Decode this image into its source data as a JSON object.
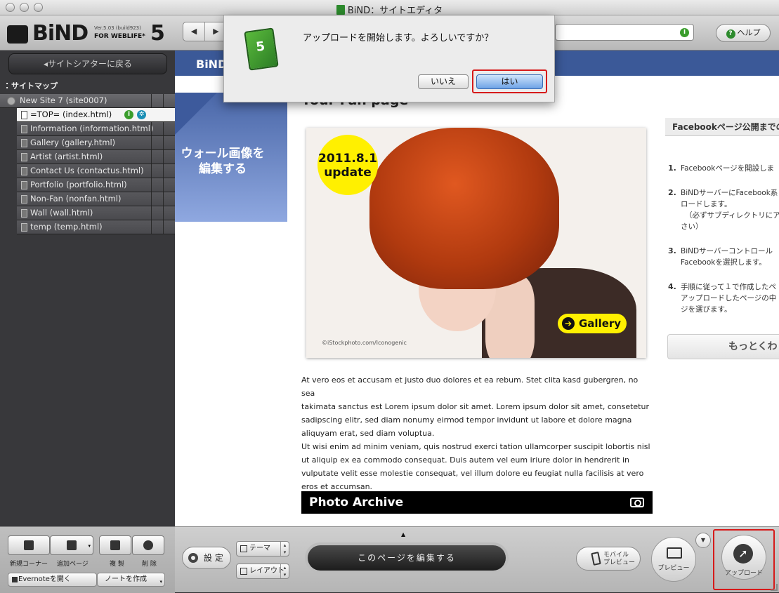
{
  "window": {
    "title": "BiND：サイトエディタ"
  },
  "logo": {
    "name": "BiND",
    "version": "Ver.5.03 (build923)",
    "subtitle": "FOR WEBLIFE*",
    "number": "5"
  },
  "nav": {
    "back": "◀",
    "forward": "▶"
  },
  "help_label": "ヘルプ",
  "sidebar": {
    "back_label": "◂サイトシアターに戻る",
    "sitemap_title": "サイトマップ",
    "root": "New Site 7 (site0007)",
    "pages": [
      {
        "label": "=TOP= (index.html)",
        "selected": true
      },
      {
        "label": "Information (information.html)"
      },
      {
        "label": "Gallery (gallery.html)"
      },
      {
        "label": "Artist (artist.html)"
      },
      {
        "label": "Contact Us (contactus.html)"
      },
      {
        "label": "Portfolio (portfolio.html)"
      },
      {
        "label": "Non-Fan (nonfan.html)"
      },
      {
        "label": "Wall (wall.html)"
      },
      {
        "label": "temp (temp.html)"
      }
    ]
  },
  "page": {
    "header_logo": "BiND",
    "wall_text_line1": "ウォール画像を",
    "wall_text_line2": "編集する",
    "fan_heading": "Your Fan page",
    "date_line1": "2011.8.1",
    "date_line2": "update",
    "gallery_label": "Gallery",
    "credit": "©iStockphoto.com/Iconogenic",
    "body_lines": [
      "At vero eos et accusam et justo duo dolores et ea rebum. Stet clita kasd gubergren, no sea",
      "takimata sanctus est Lorem ipsum dolor sit amet. Lorem ipsum dolor sit amet, consetetur",
      "sadipscing elitr, sed diam nonumy eirmod tempor invidunt ut labore et dolore magna",
      "aliquyam erat, sed diam voluptua.",
      "Ut wisi enim ad minim veniam, quis nostrud exerci tation ullamcorper suscipit lobortis nisl",
      "ut aliquip ex ea commodo consequat. Duis autem vel eum iriure dolor in hendrerit in",
      "vulputate velit esse molestie consequat, vel illum dolore eu feugiat nulla facilisis at vero",
      "eros et accumsan."
    ],
    "archive_title": "Photo Archive",
    "right_box_title": "Facebookページ公開までの",
    "steps": [
      {
        "num": "1.",
        "lines": [
          "Facebookページを開設しま"
        ]
      },
      {
        "num": "2.",
        "lines": [
          "BiNDサーバーにFacebook系",
          "ロードします。",
          "（必ずサブディレクトリにア",
          "さい）"
        ]
      },
      {
        "num": "3.",
        "lines": [
          "BiNDサーバーコントロール",
          "Facebookを選択します。"
        ]
      },
      {
        "num": "4.",
        "lines": [
          "手順に従って１で作成したペ",
          "アップロードしたページの中",
          "ジを選びます。"
        ]
      }
    ],
    "more_label": "もっとくわし"
  },
  "bottom": {
    "new_corner": "新規コーナー",
    "add_page": "追加ページ",
    "duplicate": "複 製",
    "delete": "削 除",
    "evernote": "Evernoteを開く",
    "note": "ノートを作成",
    "settings": "設 定",
    "theme": "テーマ",
    "layout": "レイアウト",
    "edit_page": "このページを編集する",
    "mobile_line1": "モバイル",
    "mobile_line2": "プレビュー",
    "preview": "プレビュー",
    "upload": "アップロード"
  },
  "dialog": {
    "message": "アップロードを開始します。よろしいですか？",
    "no": "いいえ",
    "yes": "はい"
  },
  "colors": {
    "facebook_blue": "#3b5998",
    "highlight_red": "#d61a1a",
    "badge_yellow": "#fff000"
  }
}
